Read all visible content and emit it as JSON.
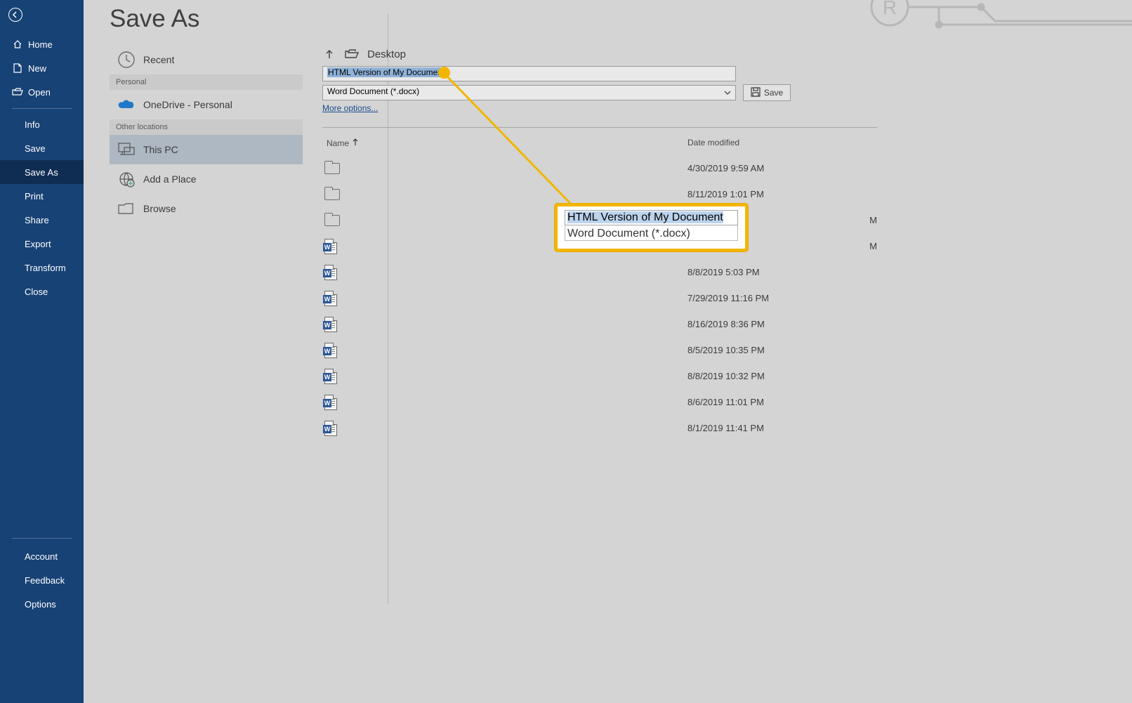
{
  "page_title": "Save As",
  "sidebar": {
    "top": [
      {
        "label": "Home",
        "icon": "home-icon"
      },
      {
        "label": "New",
        "icon": "new-file-icon"
      },
      {
        "label": "Open",
        "icon": "open-folder-icon"
      }
    ],
    "mid": [
      "Info",
      "Save",
      "Save As",
      "Print",
      "Share",
      "Export",
      "Transform",
      "Close"
    ],
    "active_mid_index": 2,
    "bottom": [
      "Account",
      "Feedback",
      "Options"
    ]
  },
  "locations": {
    "recent": "Recent",
    "personal_heading": "Personal",
    "personal": [
      {
        "label": "OneDrive - Personal",
        "icon": "onedrive-icon"
      }
    ],
    "other_heading": "Other locations",
    "other": [
      {
        "label": "This PC",
        "icon": "this-pc-icon",
        "selected": true
      },
      {
        "label": "Add a Place",
        "icon": "add-place-icon"
      },
      {
        "label": "Browse",
        "icon": "browse-folder-icon"
      }
    ]
  },
  "breadcrumb": {
    "location": "Desktop"
  },
  "filename_input": "HTML Version of My Document",
  "filetype_select": "Word Document (*.docx)",
  "more_options": "More options...",
  "save_button": "Save",
  "file_list": {
    "headers": {
      "name": "Name",
      "date": "Date modified"
    },
    "rows": [
      {
        "type": "folder",
        "name": "",
        "date": "4/30/2019 9:59 AM"
      },
      {
        "type": "folder",
        "name": "",
        "date": "8/11/2019 1:01 PM"
      },
      {
        "type": "folder",
        "name": "",
        "date": ""
      },
      {
        "type": "word",
        "name": "",
        "date": ""
      },
      {
        "type": "word",
        "name": "",
        "date": "8/8/2019 5:03 PM"
      },
      {
        "type": "word",
        "name": "",
        "date": "7/29/2019 11:16 PM"
      },
      {
        "type": "word",
        "name": "",
        "date": "8/16/2019 8:36 PM"
      },
      {
        "type": "word",
        "name": "",
        "date": "8/5/2019 10:35 PM"
      },
      {
        "type": "word",
        "name": "",
        "date": "8/8/2019 10:32 PM"
      },
      {
        "type": "word",
        "name": "",
        "date": "8/6/2019 11:01 PM"
      },
      {
        "type": "word",
        "name": "",
        "date": "8/1/2019 11:41 PM"
      }
    ],
    "partial_date_row2": "M",
    "partial_date_row3": "M"
  },
  "callout": {
    "filename": "HTML Version of My Document",
    "filetype_partial": "Word Document (*.docx)"
  }
}
